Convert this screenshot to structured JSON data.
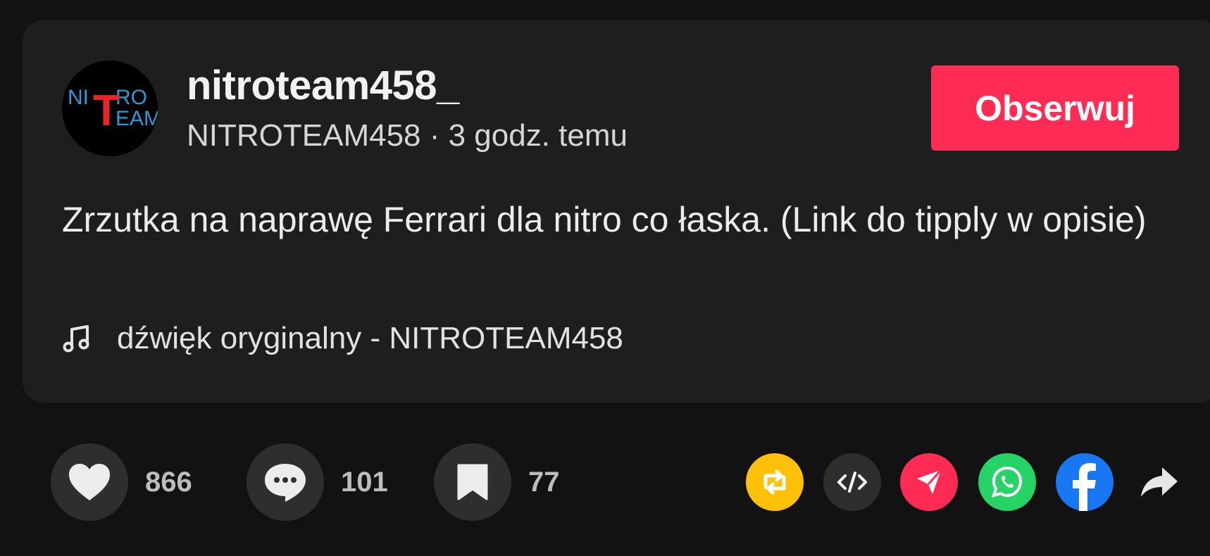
{
  "post": {
    "username": "nitroteam458_",
    "meta": "NITROTEAM458 · 3 godz. temu",
    "follow_label": "Obserwuj",
    "description": "Zrzutka na naprawę Ferrari dla nitro co łaska. (Link do tipply w opisie)",
    "sound": "dźwięk oryginalny - NITROTEAM458",
    "avatar": {
      "line1_left": "NI",
      "line1_right": "RO",
      "line2_right": "EAM",
      "big_letter": "T"
    }
  },
  "actions": {
    "likes": "866",
    "comments": "101",
    "saves": "77"
  },
  "share_icons": [
    "repost-icon",
    "embed-icon",
    "send-icon",
    "whatsapp-icon",
    "facebook-icon",
    "share-arrow-icon"
  ],
  "colors": {
    "follow": "#fe2c55",
    "repost": "#ffc107",
    "send": "#fe2c55",
    "whatsapp": "#25d366",
    "facebook": "#1877f2"
  }
}
